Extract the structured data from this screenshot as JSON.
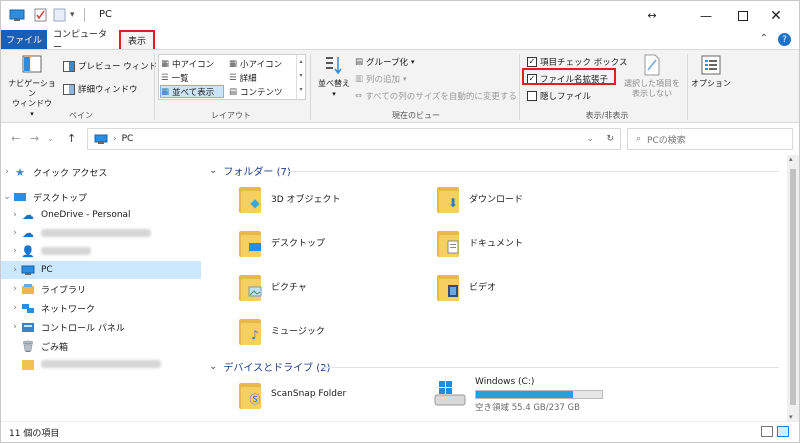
{
  "window": {
    "title": "PC"
  },
  "tabs": {
    "file": "ファイル",
    "computer": "コンピューター",
    "view": "表示"
  },
  "ribbon": {
    "pane": {
      "nav_pane": "ナビゲーション\nウィンドウ",
      "preview": "プレビュー ウィンドウ",
      "details": "詳細ウィンドウ",
      "label": "ペイン"
    },
    "layout": {
      "medium_icons": "中アイコン",
      "small_icons": "小アイコン",
      "list": "一覧",
      "details": "詳細",
      "tiles": "並べて表示",
      "content": "コンテンツ",
      "label": "レイアウト"
    },
    "current_view": {
      "sort": "並べ替え",
      "group": "グループ化",
      "add_column": "列の追加",
      "fit_columns": "すべての列のサイズを自動的に変更する",
      "label": "現在のビュー"
    },
    "show_hide": {
      "checkboxes": "項目チェック ボックス",
      "extensions": "ファイル名拡張子",
      "hidden": "隠しファイル",
      "hide_selected": "選択した項目を\n表示しない",
      "label": "表示/非表示"
    },
    "options": "オプション"
  },
  "address": {
    "path": "PC",
    "search_placeholder": "PCの検索"
  },
  "navpane": {
    "items": [
      {
        "label": "クイック アクセス"
      },
      {
        "label": "デスクトップ"
      },
      {
        "label": "OneDrive - Personal"
      },
      {
        "label": ""
      },
      {
        "label": ""
      },
      {
        "label": "PC"
      },
      {
        "label": "ライブラリ"
      },
      {
        "label": "ネットワーク"
      },
      {
        "label": "コントロール パネル"
      },
      {
        "label": "ごみ箱"
      },
      {
        "label": ""
      }
    ]
  },
  "content": {
    "folders_header": "フォルダー (7)",
    "folders": [
      "3D オブジェクト",
      "ダウンロード",
      "デスクトップ",
      "ドキュメント",
      "ピクチャ",
      "ビデオ",
      "ミュージック"
    ],
    "drives_header": "デバイスとドライブ (2)",
    "drives": [
      {
        "name": "ScanSnap Folder"
      },
      {
        "name": "Windows (C:)",
        "free": "空き領域 55.4 GB/237 GB",
        "used_fraction": 0.77
      }
    ]
  },
  "status": {
    "count": "11 個の項目"
  }
}
